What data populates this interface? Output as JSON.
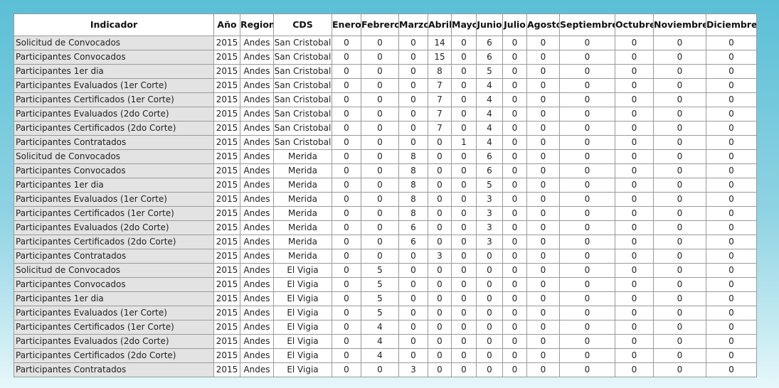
{
  "table": {
    "headers": [
      "Indicador",
      "Año",
      "Region",
      "CDS",
      "Enero",
      "Febrero",
      "Marzo",
      "Abril",
      "Mayo",
      "Junio",
      "Julio",
      "Agosto",
      "Septiembre",
      "Octubre",
      "Noviembre",
      "Diciembre"
    ],
    "rows": [
      [
        "Solicitud de Convocados",
        "2015",
        "Andes",
        "San Cristobal",
        "0",
        "0",
        "0",
        "14",
        "0",
        "6",
        "0",
        "0",
        "0",
        "0",
        "0",
        "0"
      ],
      [
        "Participantes Convocados",
        "2015",
        "Andes",
        "San Cristobal",
        "0",
        "0",
        "0",
        "15",
        "0",
        "6",
        "0",
        "0",
        "0",
        "0",
        "0",
        "0"
      ],
      [
        "Participantes 1er dia",
        "2015",
        "Andes",
        "San Cristobal",
        "0",
        "0",
        "0",
        "8",
        "0",
        "5",
        "0",
        "0",
        "0",
        "0",
        "0",
        "0"
      ],
      [
        "Participantes Evaluados (1er Corte)",
        "2015",
        "Andes",
        "San Cristobal",
        "0",
        "0",
        "0",
        "7",
        "0",
        "4",
        "0",
        "0",
        "0",
        "0",
        "0",
        "0"
      ],
      [
        "Participantes Certificados (1er Corte)",
        "2015",
        "Andes",
        "San Cristobal",
        "0",
        "0",
        "0",
        "7",
        "0",
        "4",
        "0",
        "0",
        "0",
        "0",
        "0",
        "0"
      ],
      [
        "Participantes Evaluados (2do Corte)",
        "2015",
        "Andes",
        "San Cristobal",
        "0",
        "0",
        "0",
        "7",
        "0",
        "4",
        "0",
        "0",
        "0",
        "0",
        "0",
        "0"
      ],
      [
        "Participantes Certificados (2do Corte)",
        "2015",
        "Andes",
        "San Cristobal",
        "0",
        "0",
        "0",
        "7",
        "0",
        "4",
        "0",
        "0",
        "0",
        "0",
        "0",
        "0"
      ],
      [
        "Participantes Contratados",
        "2015",
        "Andes",
        "San Cristobal",
        "0",
        "0",
        "0",
        "0",
        "1",
        "4",
        "0",
        "0",
        "0",
        "0",
        "0",
        "0"
      ],
      [
        "Solicitud de Convocados",
        "2015",
        "Andes",
        "Merida",
        "0",
        "0",
        "8",
        "0",
        "0",
        "6",
        "0",
        "0",
        "0",
        "0",
        "0",
        "0"
      ],
      [
        "Participantes Convocados",
        "2015",
        "Andes",
        "Merida",
        "0",
        "0",
        "8",
        "0",
        "0",
        "6",
        "0",
        "0",
        "0",
        "0",
        "0",
        "0"
      ],
      [
        "Participantes 1er dia",
        "2015",
        "Andes",
        "Merida",
        "0",
        "0",
        "8",
        "0",
        "0",
        "5",
        "0",
        "0",
        "0",
        "0",
        "0",
        "0"
      ],
      [
        "Participantes Evaluados (1er Corte)",
        "2015",
        "Andes",
        "Merida",
        "0",
        "0",
        "8",
        "0",
        "0",
        "3",
        "0",
        "0",
        "0",
        "0",
        "0",
        "0"
      ],
      [
        "Participantes Certificados (1er Corte)",
        "2015",
        "Andes",
        "Merida",
        "0",
        "0",
        "8",
        "0",
        "0",
        "3",
        "0",
        "0",
        "0",
        "0",
        "0",
        "0"
      ],
      [
        "Participantes Evaluados (2do Corte)",
        "2015",
        "Andes",
        "Merida",
        "0",
        "0",
        "6",
        "0",
        "0",
        "3",
        "0",
        "0",
        "0",
        "0",
        "0",
        "0"
      ],
      [
        "Participantes Certificados (2do Corte)",
        "2015",
        "Andes",
        "Merida",
        "0",
        "0",
        "6",
        "0",
        "0",
        "3",
        "0",
        "0",
        "0",
        "0",
        "0",
        "0"
      ],
      [
        "Participantes Contratados",
        "2015",
        "Andes",
        "Merida",
        "0",
        "0",
        "0",
        "3",
        "0",
        "0",
        "0",
        "0",
        "0",
        "0",
        "0",
        "0"
      ],
      [
        "Solicitud de Convocados",
        "2015",
        "Andes",
        "El Vigia",
        "0",
        "5",
        "0",
        "0",
        "0",
        "0",
        "0",
        "0",
        "0",
        "0",
        "0",
        "0"
      ],
      [
        "Participantes Convocados",
        "2015",
        "Andes",
        "El Vigia",
        "0",
        "5",
        "0",
        "0",
        "0",
        "0",
        "0",
        "0",
        "0",
        "0",
        "0",
        "0"
      ],
      [
        "Participantes 1er dia",
        "2015",
        "Andes",
        "El Vigia",
        "0",
        "5",
        "0",
        "0",
        "0",
        "0",
        "0",
        "0",
        "0",
        "0",
        "0",
        "0"
      ],
      [
        "Participantes Evaluados (1er Corte)",
        "2015",
        "Andes",
        "El Vigia",
        "0",
        "5",
        "0",
        "0",
        "0",
        "0",
        "0",
        "0",
        "0",
        "0",
        "0",
        "0"
      ],
      [
        "Participantes Certificados (1er Corte)",
        "2015",
        "Andes",
        "El Vigia",
        "0",
        "4",
        "0",
        "0",
        "0",
        "0",
        "0",
        "0",
        "0",
        "0",
        "0",
        "0"
      ],
      [
        "Participantes Evaluados (2do Corte)",
        "2015",
        "Andes",
        "El Vigia",
        "0",
        "4",
        "0",
        "0",
        "0",
        "0",
        "0",
        "0",
        "0",
        "0",
        "0",
        "0"
      ],
      [
        "Participantes Certificados (2do Corte)",
        "2015",
        "Andes",
        "El Vigia",
        "0",
        "4",
        "0",
        "0",
        "0",
        "0",
        "0",
        "0",
        "0",
        "0",
        "0",
        "0"
      ],
      [
        "Participantes Contratados",
        "2015",
        "Andes",
        "El Vigia",
        "0",
        "0",
        "3",
        "0",
        "0",
        "0",
        "0",
        "0",
        "0",
        "0",
        "0",
        "0"
      ]
    ]
  }
}
